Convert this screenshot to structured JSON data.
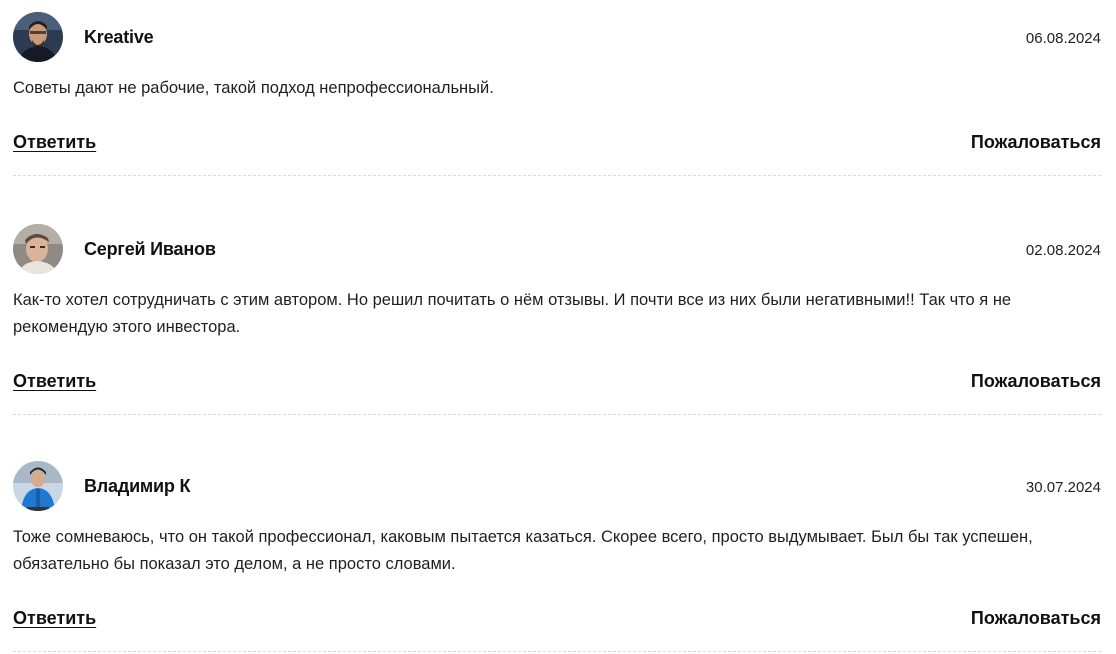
{
  "comments": [
    {
      "author": "Kreative",
      "date": "06.08.2024",
      "text": "Советы дают не рабочие, такой подход непрофессиональный.",
      "reply_label": "Ответить",
      "report_label": "Пожаловаться",
      "avatar_icon": "user-avatar-photo"
    },
    {
      "author": "Сергей Иванов",
      "date": "02.08.2024",
      "text": "Как-то хотел сотрудничать с этим автором. Но решил почитать о нём отзывы. И почти все из них были негативными!! Так что я не рекомендую этого инвестора.",
      "reply_label": "Ответить",
      "report_label": "Пожаловаться",
      "avatar_icon": "user-avatar-photo"
    },
    {
      "author": "Владимир К",
      "date": "30.07.2024",
      "text": "Тоже сомневаюсь, что он такой профессионал, каковым пытается казаться. Скорее всего, просто выдумывает. Был бы так успешен, обязательно бы показал это делом, а не просто словами.",
      "reply_label": "Ответить",
      "report_label": "Пожаловаться",
      "avatar_icon": "user-avatar-photo"
    }
  ],
  "colors": {
    "text": "#1a1a1a",
    "divider": "#d9d9d9",
    "background": "#ffffff"
  }
}
